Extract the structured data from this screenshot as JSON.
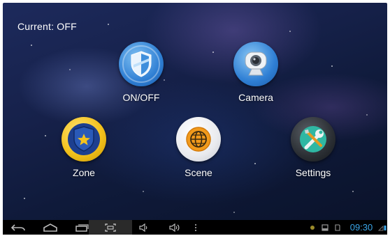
{
  "status": {
    "text": "Current:  OFF"
  },
  "tiles": [
    {
      "label": "ON/OFF",
      "icon": "shield-icon"
    },
    {
      "label": "Camera",
      "icon": "webcam-icon"
    },
    {
      "label": "Zone",
      "icon": "badge-star-icon"
    },
    {
      "label": "Scene",
      "icon": "globe-icon"
    },
    {
      "label": "Settings",
      "icon": "tools-icon"
    }
  ],
  "navbar": {
    "time": "09:30",
    "buttons": [
      "back-icon",
      "home-icon",
      "recent-apps-icon",
      "screenshot-icon",
      "volume-down-icon",
      "volume-up-icon",
      "menu-dots-icon"
    ]
  },
  "colors": {
    "accent_blue": "#2f7fd4",
    "zone_gold": "#f3c21d",
    "scene_orange": "#f19a1c",
    "settings_teal": "#2fb7a3",
    "clock_blue": "#3aa6e8"
  }
}
